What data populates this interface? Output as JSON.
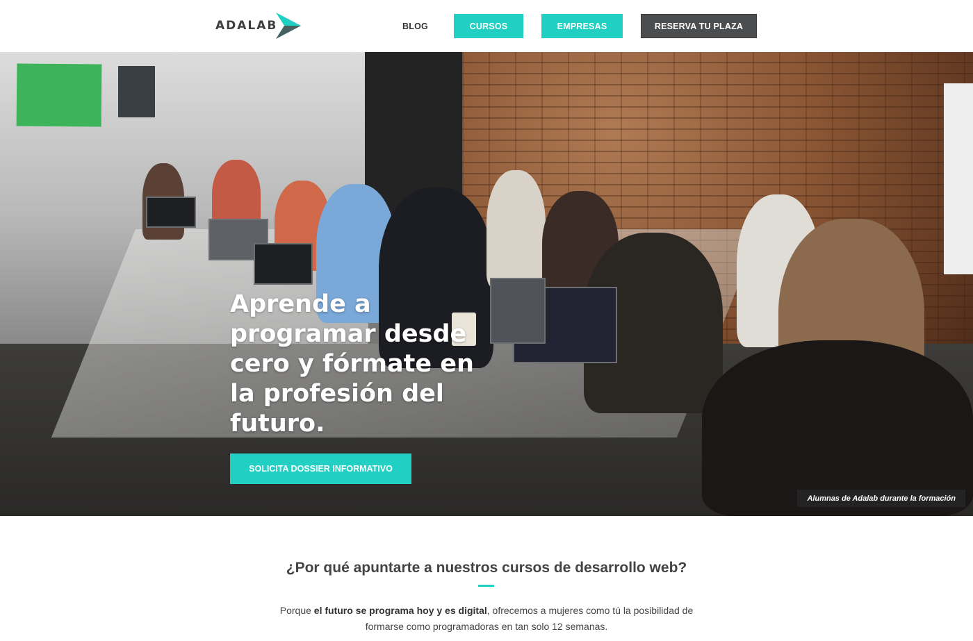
{
  "header": {
    "logo_text": "ADALAB",
    "nav": {
      "blog": "BLOG",
      "cursos": "CURSOS",
      "empresas": "EMPRESAS",
      "reserva": "RESERVA TU PLAZA"
    }
  },
  "hero": {
    "title": "Aprende a programar desde cero y fórmate en la profesión del futuro.",
    "cta": "SOLICITA DOSSIER INFORMATIVO",
    "caption": "Alumnas de Adalab durante la formación",
    "image_subject": "classroom-photo"
  },
  "intro": {
    "title": "¿Por qué apuntarte a nuestros cursos de desarrollo web?",
    "text_before": "Porque ",
    "text_bold": "el futuro se programa hoy y es digital",
    "text_after": ", ofrecemos a mujeres como tú la posibilidad de formarse como programadoras en tan solo 12 semanas."
  },
  "colors": {
    "accent": "#21d0c3",
    "dark_button": "#4c4d4f",
    "text": "#444444"
  }
}
